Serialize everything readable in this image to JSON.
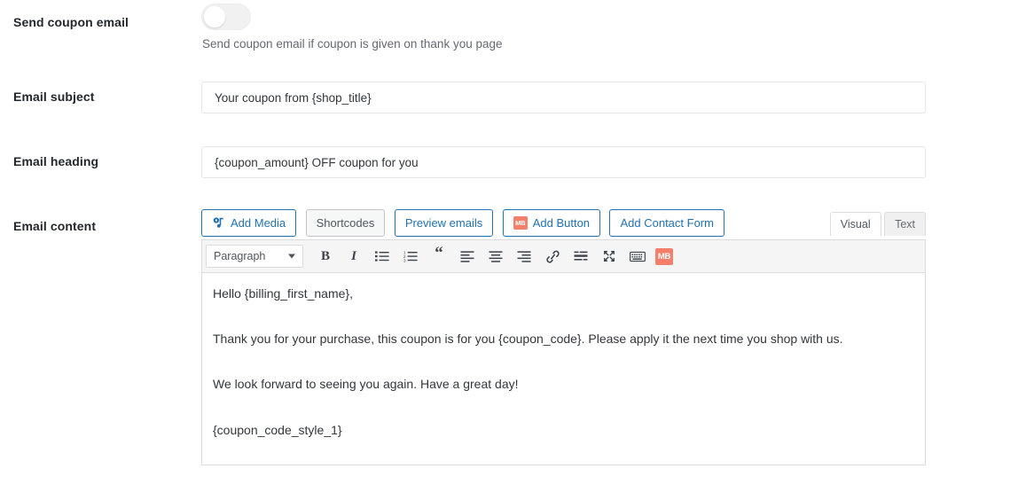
{
  "fields": {
    "send_coupon_email": {
      "label": "Send coupon email",
      "toggle_state": "off",
      "help": "Send coupon email if coupon is given on thank you page"
    },
    "email_subject": {
      "label": "Email subject",
      "value": "Your coupon from {shop_title}",
      "placeholder": "Email subject"
    },
    "email_heading": {
      "label": "Email heading",
      "value": "{coupon_amount} OFF coupon for you",
      "placeholder": "Email heading"
    },
    "email_content": {
      "label": "Email content"
    }
  },
  "media_bar": {
    "add_media": "Add Media",
    "shortcodes": "Shortcodes",
    "preview_emails": "Preview emails",
    "add_button": "Add Button",
    "add_contact_form": "Add Contact Form",
    "add_button_badge": "MB"
  },
  "editor_tabs": {
    "visual": "Visual",
    "text": "Text",
    "active": "Visual"
  },
  "editor_toolbar": {
    "format_select": "Paragraph",
    "bold": "B",
    "italic": "I",
    "mb_badge": "MB",
    "icons": [
      "bold-icon",
      "italic-icon",
      "bulleted-list-icon",
      "numbered-list-icon",
      "blockquote-icon",
      "align-left-icon",
      "align-center-icon",
      "align-right-icon",
      "insert-link-icon",
      "read-more-icon",
      "fullscreen-icon",
      "keyboard-shortcuts-icon",
      "mb-button-icon"
    ]
  },
  "editor_content": {
    "paragraphs": [
      "Hello {billing_first_name},",
      "Thank you for your purchase, this coupon is for you {coupon_code}. Please apply it the next time you shop with us.",
      "We look forward to seeing you again. Have a great day!",
      "{coupon_code_style_1}"
    ]
  },
  "colors": {
    "link_blue": "#2271b1",
    "accent_salmon": "#f4806b",
    "text_dark": "#23282d",
    "text_muted": "#646970",
    "border": "#dcdcde"
  }
}
